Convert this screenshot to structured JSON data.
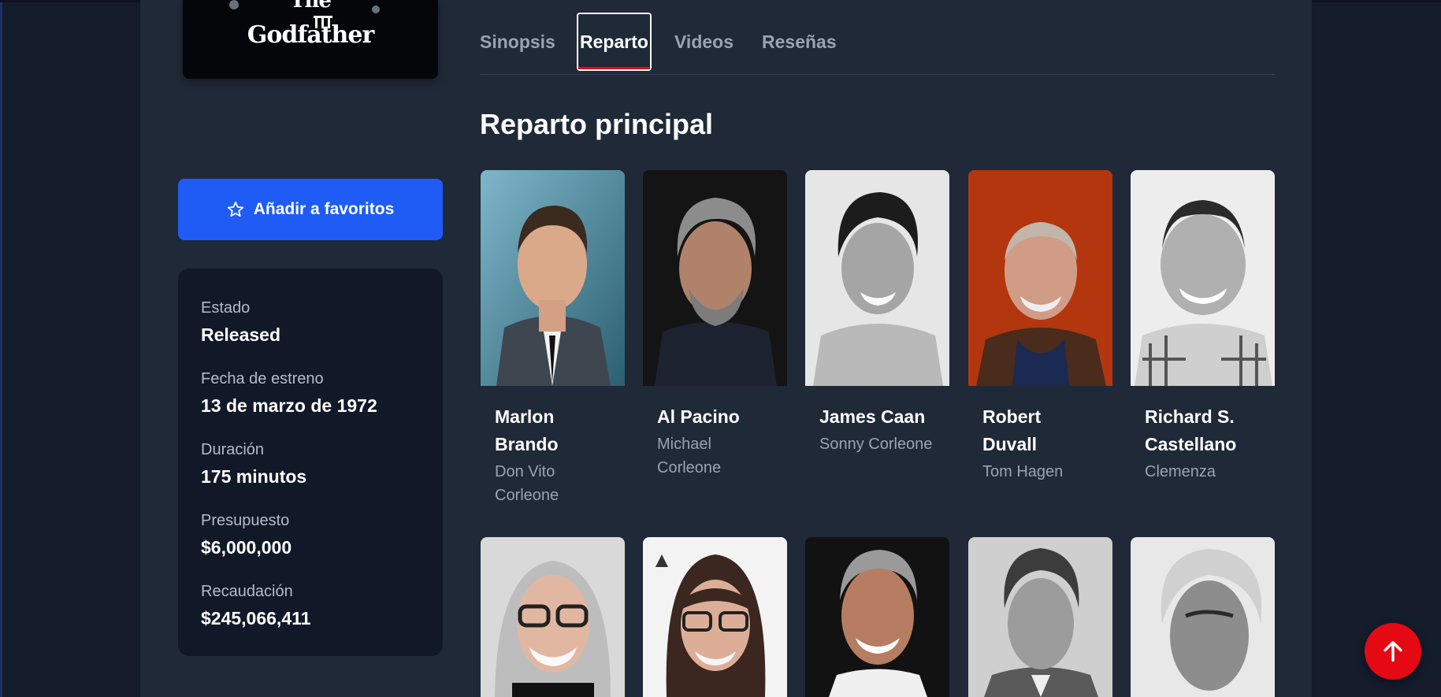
{
  "poster": {
    "title_line1": "The",
    "title_line2": "Godfather"
  },
  "favorites_button": {
    "icon": "star-icon",
    "label": "Añadir a favoritos"
  },
  "info": [
    {
      "label": "Estado",
      "value": "Released"
    },
    {
      "label": "Fecha de estreno",
      "value": "13 de marzo de 1972"
    },
    {
      "label": "Duración",
      "value": "175 minutos"
    },
    {
      "label": "Presupuesto",
      "value": "$6,000,000"
    },
    {
      "label": "Recaudación",
      "value": "$245,066,411"
    }
  ],
  "tabs": [
    {
      "label": "Sinopsis",
      "active": false
    },
    {
      "label": "Reparto",
      "active": true
    },
    {
      "label": "Videos",
      "active": false
    },
    {
      "label": "Reseñas",
      "active": false
    }
  ],
  "section_title": "Reparto principal",
  "cast_row1": [
    {
      "name": "Marlon Brando",
      "character": "Don Vito Corleone"
    },
    {
      "name": "Al Pacino",
      "character": "Michael Corleone"
    },
    {
      "name": "James Caan",
      "character": "Sonny Corleone"
    },
    {
      "name": "Robert Duvall",
      "character": "Tom Hagen"
    },
    {
      "name": "Richard S. Castellano",
      "character": "Clemenza"
    }
  ],
  "cast_row2_count_visible": 5,
  "scroll_top_icon": "arrow-up-icon",
  "colors": {
    "accent_red": "#e50914",
    "favorites_blue": "#1e5cf5",
    "panel_bg": "#1f2937",
    "card_bg": "#111827"
  }
}
